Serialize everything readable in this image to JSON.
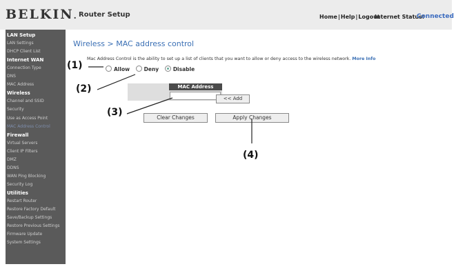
{
  "header": {
    "logo": "BELKIN",
    "title": "Router Setup",
    "links": [
      "Home",
      "Help",
      "Logout"
    ],
    "status_label": "Internet Status:",
    "status_value": "Connected"
  },
  "sidebar": {
    "items": [
      {
        "label": "LAN Setup",
        "section": true
      },
      {
        "label": "LAN Settings"
      },
      {
        "label": "DHCP Client List"
      },
      {
        "label": "Internet WAN",
        "section": true
      },
      {
        "label": "Connection Type"
      },
      {
        "label": "DNS"
      },
      {
        "label": "MAC Address"
      },
      {
        "label": "Wireless",
        "section": true
      },
      {
        "label": "Channel and SSID"
      },
      {
        "label": "Security"
      },
      {
        "label": "Use as Access Point"
      },
      {
        "label": "MAC Address Control",
        "active": true
      },
      {
        "label": "Firewall",
        "section": true
      },
      {
        "label": "Virtual Servers"
      },
      {
        "label": "Client IP Filters"
      },
      {
        "label": "DMZ"
      },
      {
        "label": "DDNS"
      },
      {
        "label": "WAN Ping Blocking"
      },
      {
        "label": "Security Log"
      },
      {
        "label": "Utilities",
        "section": true
      },
      {
        "label": "Restart Router"
      },
      {
        "label": "Restore Factory Default"
      },
      {
        "label": "Save/Backup Settings"
      },
      {
        "label": "Restore Previous Settings"
      },
      {
        "label": "Firmware Update"
      },
      {
        "label": "System Settings"
      }
    ]
  },
  "main": {
    "page_title": "Wireless > MAC address control",
    "description": "Mac Address Control is the ability to set up a list of clients that you want to allow or deny access to the wireless network.",
    "more_info": "More Info",
    "mode_options": [
      {
        "label": "Allow",
        "checked": false
      },
      {
        "label": "Deny",
        "checked": false
      },
      {
        "label": "Disable",
        "checked": true
      }
    ],
    "mac_table_header": "MAC Address",
    "mac_input_value": "",
    "add_label": "<< Add",
    "clear_label": "Clear Changes",
    "apply_label": "Apply Changes"
  },
  "callouts": [
    "(1)",
    "(2)",
    "(3)",
    "(4)"
  ],
  "colors": {
    "accent": "#3a6fb4",
    "sidebar_bg": "#5a5a5a",
    "header_bg": "#ececec",
    "table_header_bg": "#4b4b4b"
  }
}
